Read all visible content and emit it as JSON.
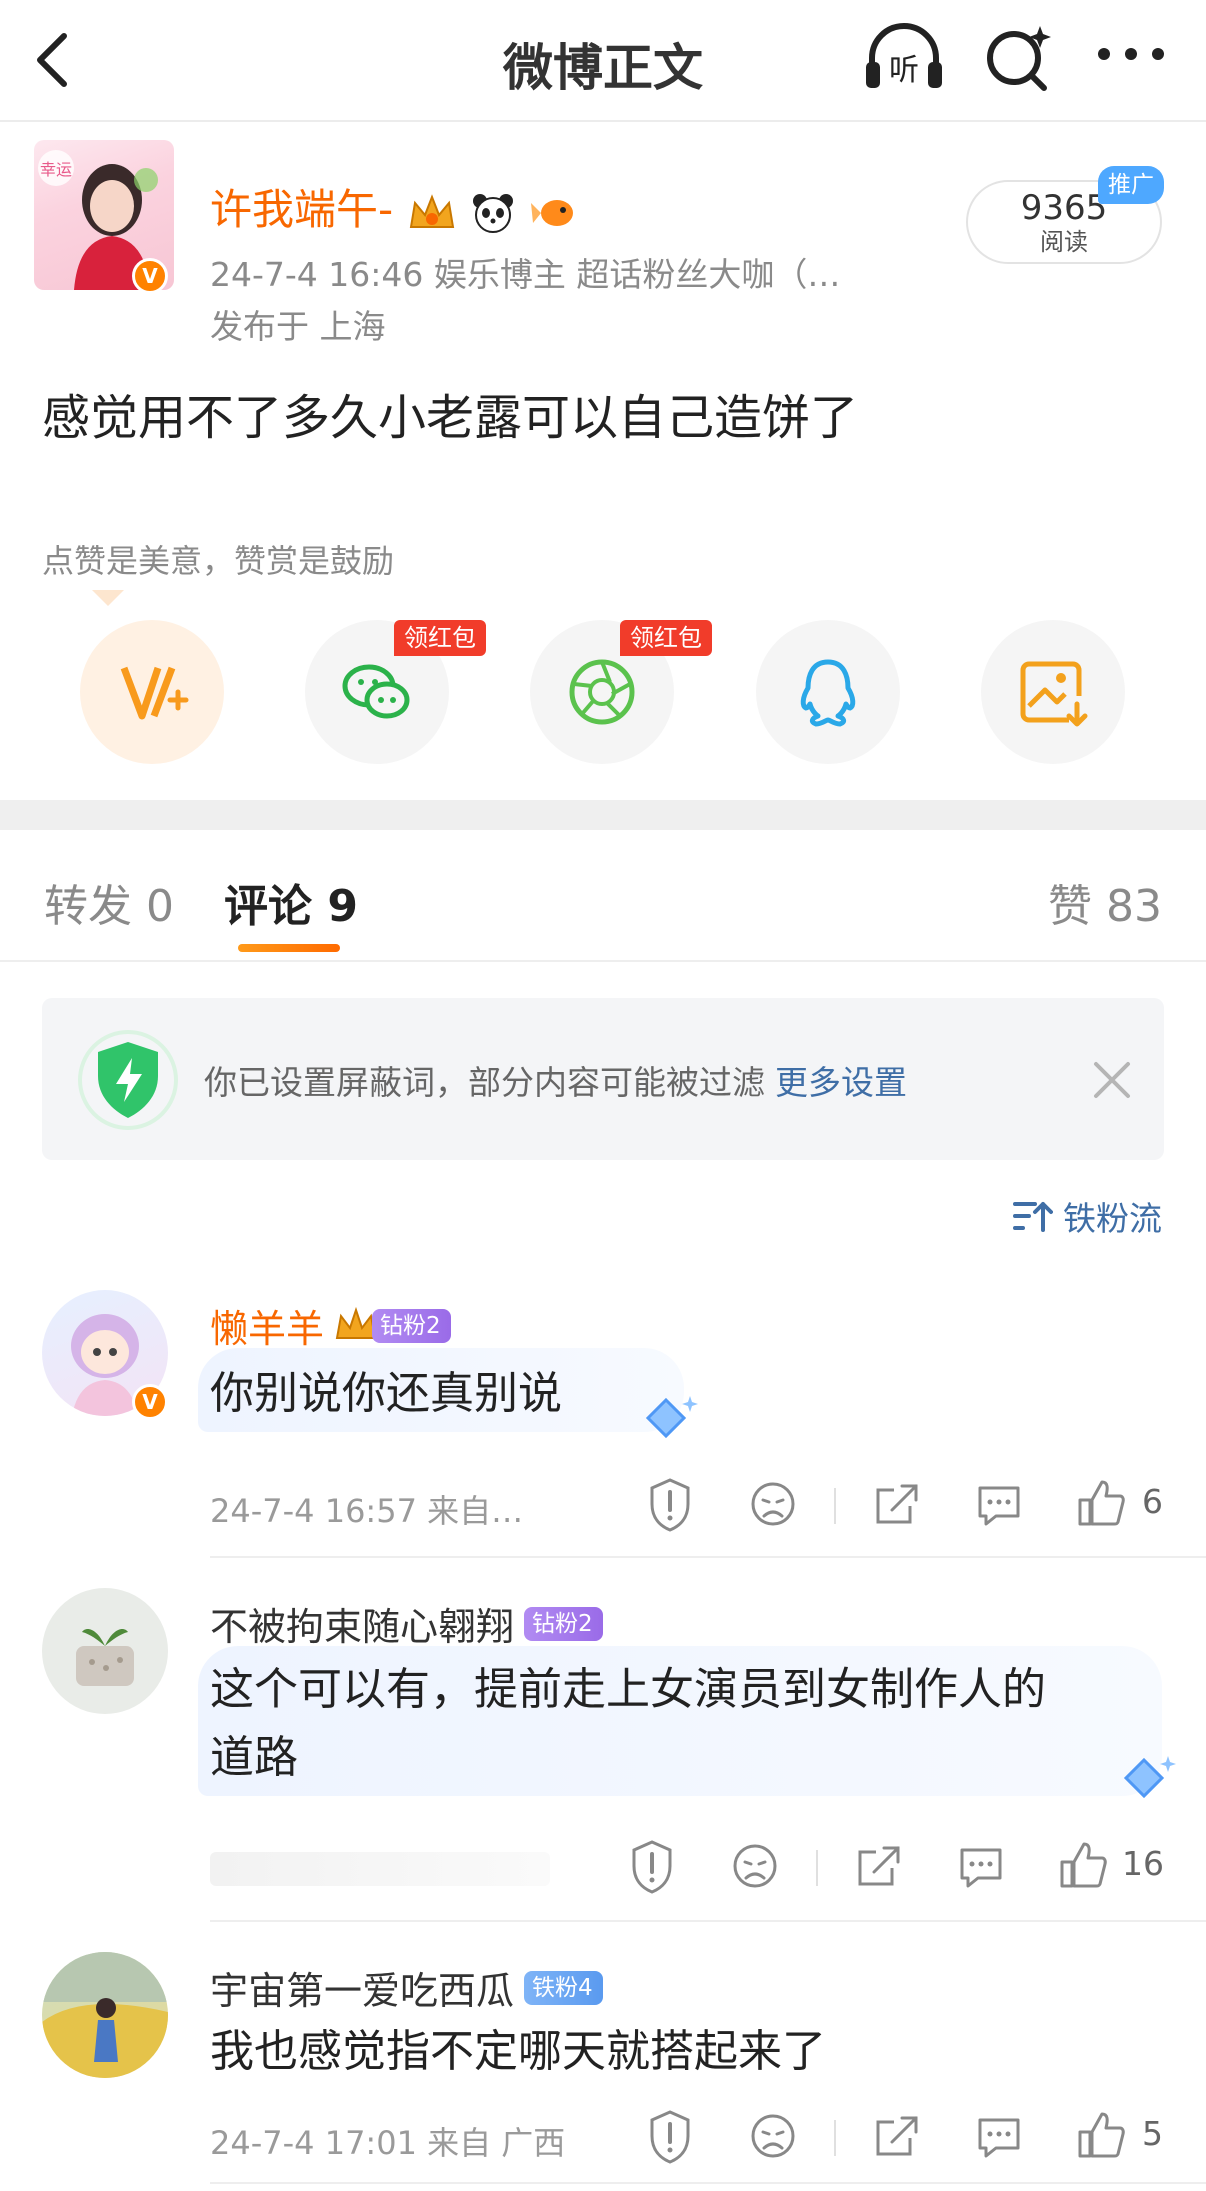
{
  "nav": {
    "title": "微博正文",
    "listen_icon": "headphone-listen-icon",
    "search_icon": "sparkle-search-icon",
    "more_icon": "more-dots-icon"
  },
  "author": {
    "name": "许我端午-",
    "avatar_tag": "幸运",
    "meta_line": "24-7-4 16:46  娱乐博主 超话粉丝大咖（…",
    "location": "发布于 上海",
    "reads_count": "9365",
    "reads_label": "阅读",
    "promo_label": "推广",
    "verified_mark": "V"
  },
  "post": {
    "text": "感觉用不了多久小老露可以自己造饼了"
  },
  "reward": {
    "hint": "点赞是美意，赞赏是鼓励"
  },
  "share": {
    "redpack_label": "领红包"
  },
  "tabs": {
    "repost": "转发 0",
    "comments": "评论 9",
    "likes": "赞 83"
  },
  "notice": {
    "text": "你已设置屏蔽词，部分内容可能被过滤",
    "link": "更多设置"
  },
  "sort": {
    "label": "铁粉流"
  },
  "comments": [
    {
      "name": "懒羊羊",
      "badge": "钻粉2",
      "text": "你别说你还真别说",
      "meta": "24-7-4 16:57  来自…",
      "likes": "6",
      "name_color": "#f86700"
    },
    {
      "name": "不被拘束随心翱翔",
      "badge": "钻粉2",
      "text": "这个可以有，提前走上女演员到女制作人的",
      "text2": "道路",
      "meta": "",
      "likes": "16",
      "name_color": "#333333"
    },
    {
      "name": "宇宙第一爱吃西瓜",
      "badge": "铁粉4",
      "text": "我也感觉指不定哪天就搭起来了",
      "meta": "24-7-4 17:01  来自 广西",
      "likes": "5",
      "name_color": "#333333"
    }
  ],
  "colors": {
    "accent_orange": "#f86700",
    "link_blue": "#3f6ea6",
    "redpack": "#f13c2a"
  }
}
